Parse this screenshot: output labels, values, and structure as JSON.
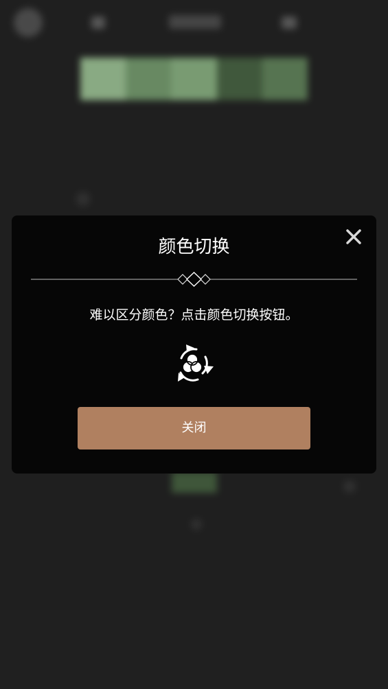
{
  "colors": {
    "page_background": "#272727",
    "modal_background": "#060606",
    "button_background": "#b08060",
    "text": "#ffffff"
  },
  "background_game": {
    "palette_swatches": [
      "#a8d0a0",
      "#7fa878",
      "#94be8c",
      "#4f6c4a",
      "#6a8e63"
    ],
    "icons": [
      "avatar-icon",
      "left-menu-icon",
      "score-display",
      "right-menu-icon"
    ]
  },
  "modal": {
    "title": "颜色切换",
    "message": "难以区分颜色？点击颜色切换按钮。",
    "close_icon": "close-icon",
    "divider_icon": "diamond-ornament-icon",
    "color_switch_icon": "color-switch-icon",
    "button_label": "关闭"
  }
}
